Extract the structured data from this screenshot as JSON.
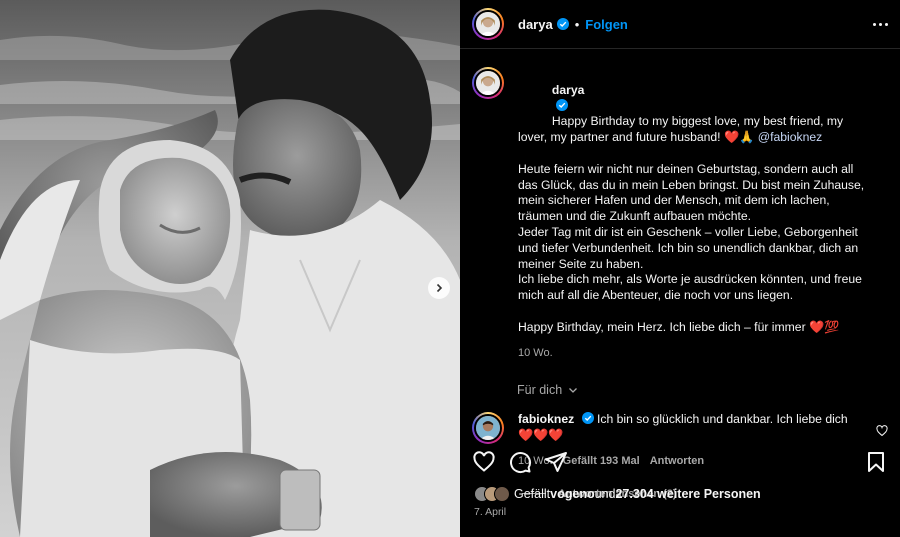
{
  "header": {
    "username": "darya",
    "separator": "•",
    "follow_label": "Folgen"
  },
  "caption": {
    "username": "darya",
    "first_line": "Happy Birthday to my biggest love, my best friend, my lover, my partner and future husband! ❤️🙏 ",
    "mention": "@fabioknez",
    "body": "Heute feiern wir nicht nur deinen Geburtstag, sondern auch all das Glück, das du in mein Leben bringst. Du bist mein Zuhause, mein sicherer Hafen und der Mensch, mit dem ich lachen, träumen und die Zukunft aufbauen möchte.\nJeder Tag mit dir ist ein Geschenk – voller Liebe, Geborgenheit und tiefer Verbundenheit. Ich bin so unendlich dankbar, dich an meiner Seite zu haben.\nIch liebe dich mehr, als Worte je ausdrücken könnten, und freue mich auf all die Abenteuer, die noch vor uns liegen.\n\nHappy Birthday, mein Herz. Ich liebe dich – für immer ❤️💯",
    "time": "10 Wo."
  },
  "for_you_label": "Für dich",
  "comment": {
    "username": "fabioknez",
    "text": "Ich bin so glücklich und dankbar. Ich liebe dich❤️❤️❤️",
    "time": "10 Wo.",
    "likes": "Gefällt 193 Mal",
    "reply_label": "Antworten",
    "view_replies": "Antworten ansehen (2)"
  },
  "likes": {
    "prefix": "Gefällt ",
    "user": "vogeno",
    "middle": " und ",
    "count": "27.304 weitere Personen"
  },
  "date": "7. April",
  "icons": {
    "verified": "verified-badge-icon",
    "more": "more-options-icon",
    "next": "chevron-right-icon",
    "like": "heart-icon",
    "comment": "comment-bubble-icon",
    "share": "paper-plane-icon",
    "save": "bookmark-icon"
  },
  "colors": {
    "accent": "#0095f6",
    "background": "#000000",
    "muted": "#a8a8a8",
    "text": "#f5f5f5"
  }
}
